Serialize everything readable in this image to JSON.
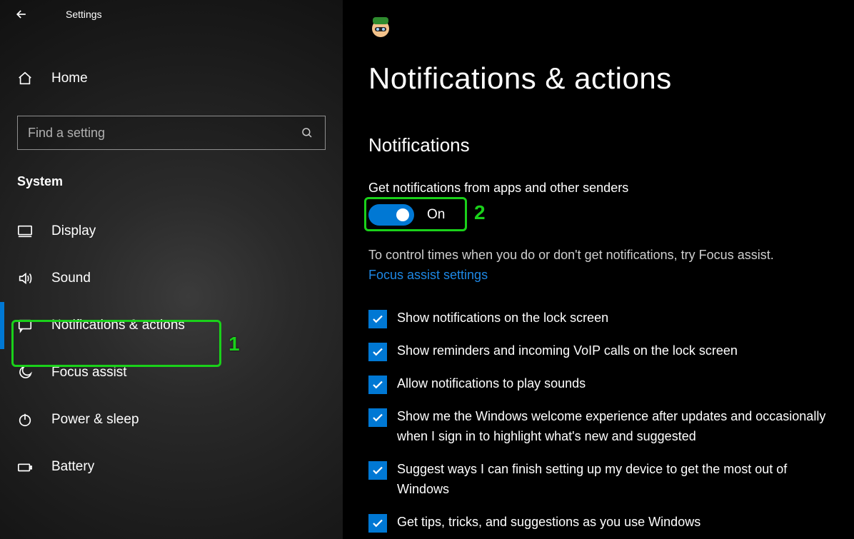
{
  "title": "Settings",
  "home": "Home",
  "search": {
    "placeholder": "Find a setting"
  },
  "section": "System",
  "nav": [
    {
      "label": "Display"
    },
    {
      "label": "Sound"
    },
    {
      "label": "Notifications & actions"
    },
    {
      "label": "Focus assist"
    },
    {
      "label": "Power & sleep"
    },
    {
      "label": "Battery"
    }
  ],
  "page": {
    "title": "Notifications & actions",
    "subheading": "Notifications",
    "notify_label": "Get notifications from apps and other senders",
    "toggle_state": "On",
    "desc": "To control times when you do or don't get notifications, try Focus assist.",
    "link": "Focus assist settings",
    "checks": [
      "Show notifications on the lock screen",
      "Show reminders and incoming VoIP calls on the lock screen",
      "Allow notifications to play sounds",
      "Show me the Windows welcome experience after updates and occasionally when I sign in to highlight what's new and suggested",
      "Suggest ways I can finish setting up my device to get the most out of Windows",
      "Get tips, tricks, and suggestions as you use Windows"
    ]
  },
  "annotations": {
    "one": "1",
    "two": "2"
  }
}
